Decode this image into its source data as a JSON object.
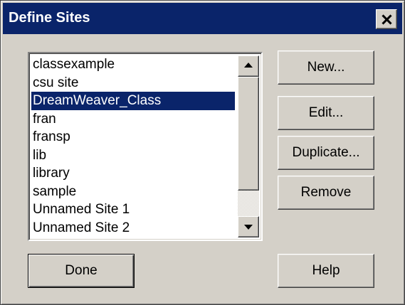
{
  "window": {
    "title": "Define Sites"
  },
  "sites": {
    "items": [
      "classexample",
      "csu site",
      "DreamWeaver_Class",
      "fran",
      "fransp",
      "lib",
      "library",
      "sample",
      "Unnamed Site 1",
      "Unnamed Site 2"
    ],
    "selected": "DreamWeaver_Class"
  },
  "buttons": {
    "new_label": "New...",
    "edit_label": "Edit...",
    "duplicate_label": "Duplicate...",
    "remove_label": "Remove",
    "done_label": "Done",
    "help_label": "Help"
  },
  "icons": {
    "close": "close-icon",
    "scroll_up": "scroll-up-arrow-icon",
    "scroll_down": "scroll-down-arrow-icon"
  },
  "colors": {
    "titlebar": "#0a246a",
    "selection": "#0a246a",
    "face": "#d4d0c8"
  }
}
